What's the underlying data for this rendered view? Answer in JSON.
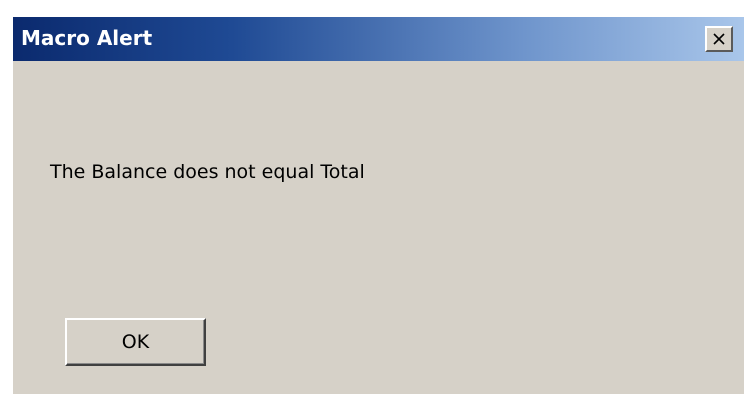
{
  "dialog": {
    "title": "Macro Alert",
    "message": "The Balance does not equal Total",
    "ok_label": "OK"
  },
  "icons": {
    "close": "close-icon"
  },
  "colors": {
    "titlebar_start": "#0b2a6e",
    "titlebar_end": "#a9c6ea",
    "dialog_background": "#d6d1c8",
    "title_text": "#ffffff"
  }
}
